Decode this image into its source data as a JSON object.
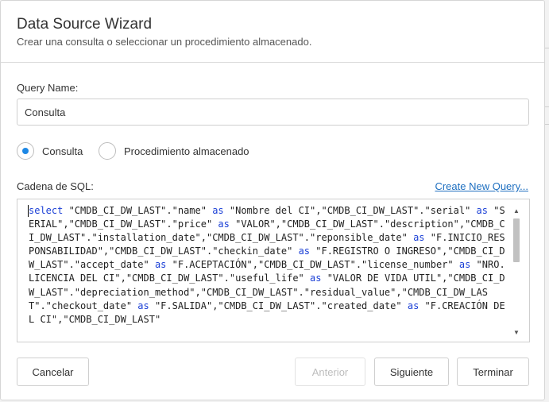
{
  "dialog": {
    "title": "Data Source Wizard",
    "subtitle": "Crear una consulta o seleccionar un procedimiento almacenado."
  },
  "query_name": {
    "label": "Query Name:",
    "value": "Consulta"
  },
  "mode": {
    "options": [
      {
        "label": "Consulta",
        "checked": true
      },
      {
        "label": "Procedimiento almacenado",
        "checked": false
      }
    ]
  },
  "sql": {
    "label": "Cadena de SQL:",
    "create_link": "Create New Query...",
    "text": "select \"CMDB_CI_DW_LAST\".\"name\" as \"Nombre del CI\",\"CMDB_CI_DW_LAST\".\"serial\" as \"SERIAL\",\"CMDB_CI_DW_LAST\".\"price\" as \"VALOR\",\"CMDB_CI_DW_LAST\".\"description\",\"CMDB_CI_DW_LAST\".\"installation_date\",\"CMDB_CI_DW_LAST\".\"reponsible_date\" as \"F.INICIO_RESPONSABILIDAD\",\"CMDB_CI_DW_LAST\".\"checkin_date\" as \"F.REGISTRO O INGRESO\",\"CMDB_CI_DW_LAST\".\"accept_date\" as \"F.ACEPTACIÓN\",\"CMDB_CI_DW_LAST\".\"license_number\" as \"NRO.LICENCIA DEL CI\",\"CMDB_CI_DW_LAST\".\"useful_life\" as \"VALOR DE VIDA UTIL\",\"CMDB_CI_DW_LAST\".\"depreciation_method\",\"CMDB_CI_DW_LAST\".\"residual_value\",\"CMDB_CI_DW_LAST\".\"checkout_date\" as \"F.SALIDA\",\"CMDB_CI_DW_LAST\".\"created_date\" as \"F.CREACIÓN DEL CI\",\"CMDB_CI_DW_LAST\""
  },
  "buttons": {
    "cancel": "Cancelar",
    "previous": "Anterior",
    "next": "Siguiente",
    "finish": "Terminar"
  },
  "colors": {
    "accent": "#1e88e5",
    "link": "#1e6fc0",
    "keyword": "#1a3fd6"
  }
}
